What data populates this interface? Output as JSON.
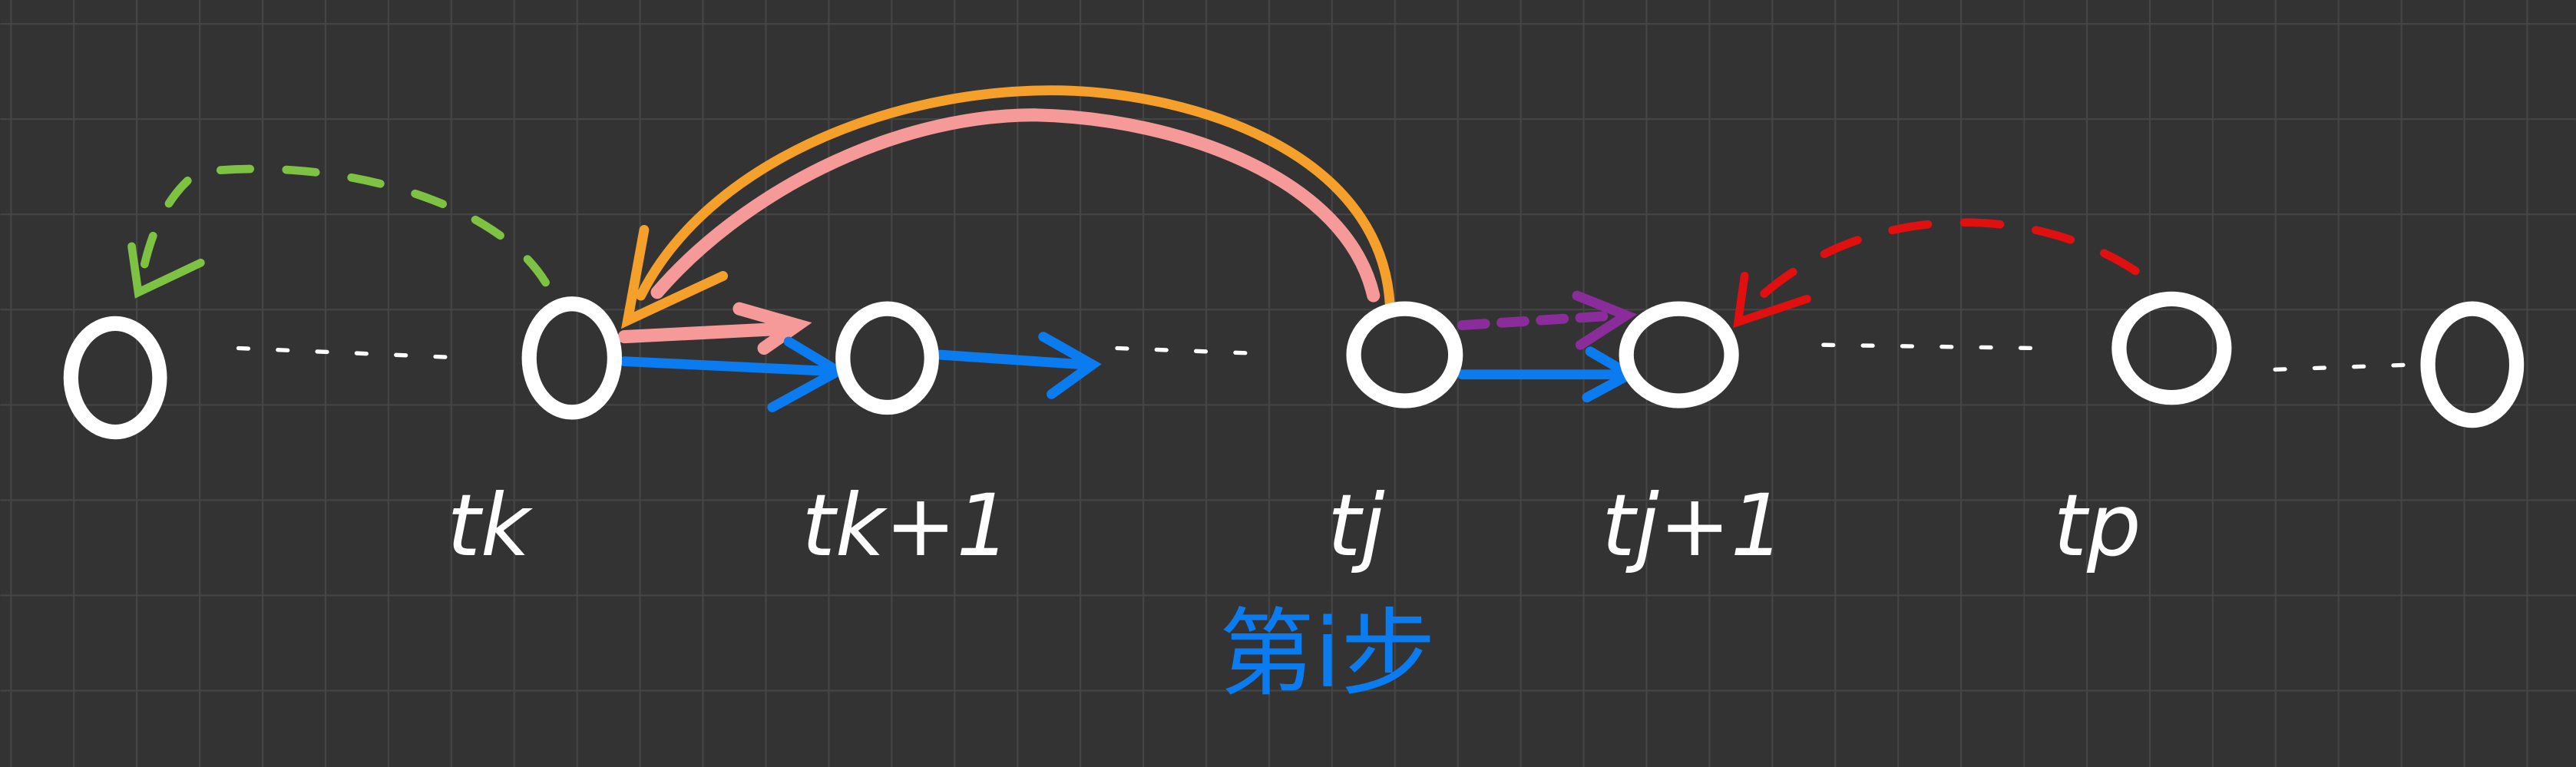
{
  "colors": {
    "background": "#333333",
    "grid": "#454545",
    "node": "#ffffff",
    "green": "#7dc242",
    "orange": "#f5a02a",
    "pink": "#f59a98",
    "blue": "#0a7cf0",
    "purple": "#8a2d9a",
    "red": "#e01010"
  },
  "nodes": [
    {
      "label": ""
    },
    {
      "label": "tk"
    },
    {
      "label": "tk+1"
    },
    {
      "label": "tj"
    },
    {
      "label": "tj+1"
    },
    {
      "label": "tp"
    },
    {
      "label": ""
    }
  ],
  "annotation": "第i步"
}
